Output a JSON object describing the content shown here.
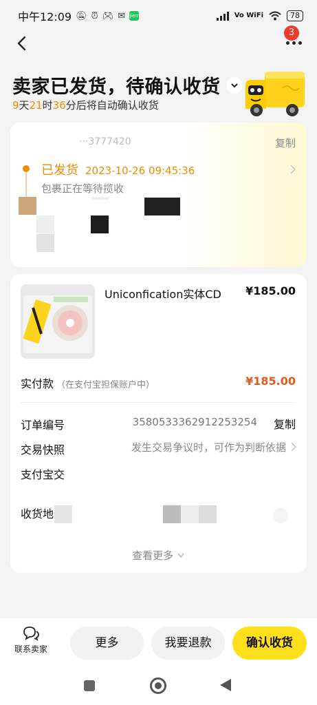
{
  "status_bar": {
    "time": "中午12:09",
    "battery": "78",
    "volte": "Vo WiFi",
    "app_badge": "jiem"
  },
  "nav": {
    "badge_count": "3"
  },
  "header": {
    "title": "卖家已发货，待确认收货",
    "countdown": {
      "days": "9",
      "days_unit": "天",
      "hours": "21",
      "hours_unit": "时",
      "minutes": "36",
      "suffix": "分后将自动确认收货"
    }
  },
  "logistics": {
    "tracking_mask": "···3777420",
    "copy_label": "复制",
    "status": "已发货",
    "timestamp": "2023-10-26 09:45:36",
    "detail": "包裹正在等待揽收"
  },
  "order": {
    "product_title": "Uniconfication实体CD",
    "product_price": "¥185.00",
    "paid_label": "实付款",
    "paid_note": "（在支付宝担保账户中）",
    "paid_amount": "¥185.00",
    "order_no_label": "订单编号",
    "order_no": "3580533362912253254",
    "copy_label": "复制",
    "snapshot_label": "交易快照",
    "snapshot_text": "发生交易争议时，可作为判断依据",
    "alipay_label": "支付宝交",
    "address_label": "收货地",
    "view_more": "查看更多"
  },
  "bottom_bar": {
    "contact_label": "联系卖家",
    "more_label": "更多",
    "refund_label": "我要退款",
    "confirm_label": "确认收货"
  },
  "colors": {
    "accent_orange": "#f08c00",
    "price_red": "#e05a1a",
    "confirm_yellow": "#ffe01b",
    "badge_red": "#ef3b2b"
  }
}
